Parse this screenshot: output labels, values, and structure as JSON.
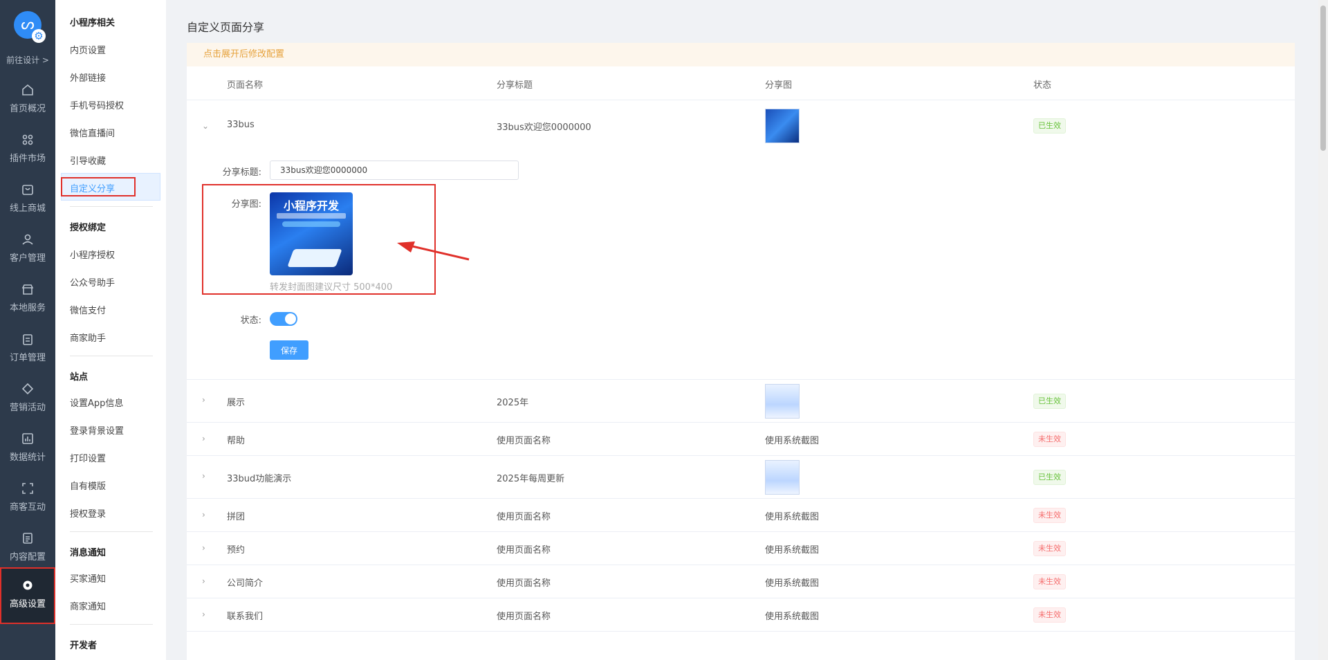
{
  "rail": {
    "goto": "前往设计 >",
    "items": [
      "首页概况",
      "插件市场",
      "线上商城",
      "客户管理",
      "本地服务",
      "订单管理",
      "营销活动",
      "数据统计",
      "商客互动",
      "内容配置",
      "高级设置"
    ]
  },
  "subnav": {
    "g1": "小程序相关",
    "g1_items": [
      "内页设置",
      "外部链接",
      "手机号码授权",
      "微信直播间",
      "引导收藏",
      "自定义分享"
    ],
    "g2": "授权绑定",
    "g2_items": [
      "小程序授权",
      "公众号助手",
      "微信支付",
      "商家助手"
    ],
    "g3": "站点",
    "g3_items": [
      "设置App信息",
      "登录背景设置",
      "打印设置",
      "自有模版",
      "授权登录"
    ],
    "g4": "消息通知",
    "g4_items": [
      "买家通知",
      "商家通知"
    ],
    "g5": "开发者"
  },
  "page": {
    "title": "自定义页面分享",
    "tip": "点击展开后修改配置"
  },
  "table": {
    "headers": [
      "页面名称",
      "分享标题",
      "分享图",
      "状态"
    ],
    "rows": [
      {
        "name": "33bus",
        "title": "33bus欢迎您0000000",
        "image": "thumb",
        "status": "已生效"
      },
      {
        "name": "展示",
        "title": "2025年",
        "image": "thumb",
        "status": "已生效"
      },
      {
        "name": "帮助",
        "title": "使用页面名称",
        "image": "使用系统截图",
        "status": "未生效"
      },
      {
        "name": "33bud功能演示",
        "title": "2025年每周更新",
        "image": "thumb",
        "status": "已生效"
      },
      {
        "name": "拼团",
        "title": "使用页面名称",
        "image": "使用系统截图",
        "status": "未生效"
      },
      {
        "name": "预约",
        "title": "使用页面名称",
        "image": "使用系统截图",
        "status": "未生效"
      },
      {
        "name": "公司简介",
        "title": "使用页面名称",
        "image": "使用系统截图",
        "status": "未生效"
      },
      {
        "name": "联系我们",
        "title": "使用页面名称",
        "image": "使用系统截图",
        "status": "未生效"
      }
    ]
  },
  "form": {
    "title_label": "分享标题:",
    "title_value": "33bus欢迎您0000000",
    "image_label": "分享图:",
    "image_title": "小程序开发",
    "hint": "转发封面图建议尺寸 500*400",
    "status_label": "状态:",
    "save": "保存"
  }
}
